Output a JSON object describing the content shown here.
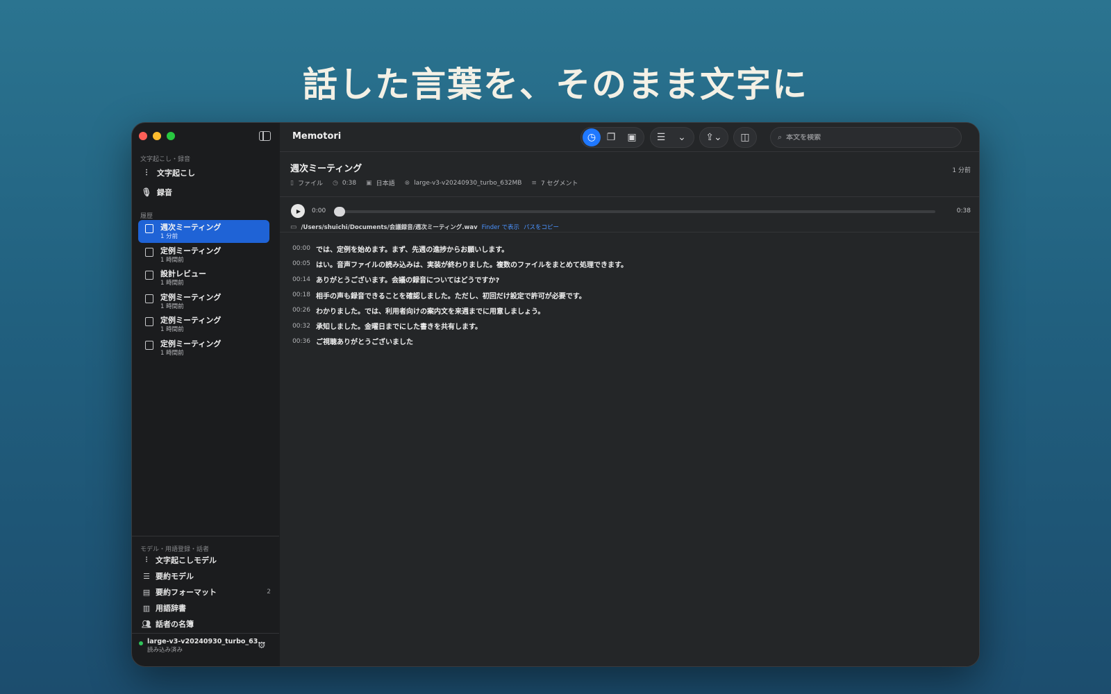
{
  "headline": "話した言葉を、そのまま文字に",
  "sidebar": {
    "section_transcribe": "文字起こし・録音",
    "nav": [
      {
        "label": "文字起こし",
        "icon": "waveform-icon"
      },
      {
        "label": "録音",
        "icon": "microphone-icon"
      }
    ],
    "section_history": "履歴",
    "history": [
      {
        "title": "週次ミーティング",
        "time": "1 分前",
        "active": true
      },
      {
        "title": "定例ミーティング",
        "time": "1 時間前"
      },
      {
        "title": "設計レビュー",
        "time": "1 時間前"
      },
      {
        "title": "定例ミーティング",
        "time": "1 時間前"
      },
      {
        "title": "定例ミーティング",
        "time": "1 時間前"
      },
      {
        "title": "定例ミーティング",
        "time": "1 時間前"
      }
    ],
    "section_tools": "モデル・用語登録・話者",
    "tools": [
      {
        "label": "文字起こしモデル",
        "icon": "waveform-icon"
      },
      {
        "label": "要約モデル",
        "icon": "list-icon"
      },
      {
        "label": "要約フォーマット",
        "icon": "format-icon",
        "count": "2"
      },
      {
        "label": "用語辞書",
        "icon": "book-icon"
      },
      {
        "label": "話者の名簿",
        "icon": "people-icon"
      }
    ],
    "model_name": "large-v3-v20240930_turbo_63...",
    "model_status": "読み込み済み"
  },
  "toolbar": {
    "app_title": "Memotori",
    "search_placeholder": "本文を検索"
  },
  "document": {
    "title": "週次ミーティング",
    "ago": "1 分前",
    "source": "ファイル",
    "duration": "0:38",
    "language": "日本語",
    "model": "large-v3-v20240930_turbo_632MB",
    "segments_count": "7 セグメント"
  },
  "player": {
    "current": "0:00",
    "total": "0:38",
    "progress": 0.0,
    "path": "/Users/shuichi/Documents/会議録音/週次ミーティング.wav",
    "show_in_finder": "Finder で表示",
    "copy_path": "パスをコピー"
  },
  "segments": [
    {
      "time": "00:00",
      "text": "では、定例を始めます。まず、先週の進捗からお願いします。"
    },
    {
      "time": "00:05",
      "text": "はい。音声ファイルの読み込みは、実装が終わりました。複数のファイルをまとめて処理できます。"
    },
    {
      "time": "00:14",
      "text": "ありがとうございます。会議の録音についてはどうですか?"
    },
    {
      "time": "00:18",
      "text": "相手の声も録音できることを確認しました。ただし、初回だけ設定で許可が必要です。"
    },
    {
      "time": "00:26",
      "text": "わかりました。では、利用者向けの案内文を来週までに用意しましょう。"
    },
    {
      "time": "00:32",
      "text": "承知しました。金曜日までにした書きを共有します。"
    },
    {
      "time": "00:36",
      "text": "ご視聴ありがとうございました"
    }
  ]
}
